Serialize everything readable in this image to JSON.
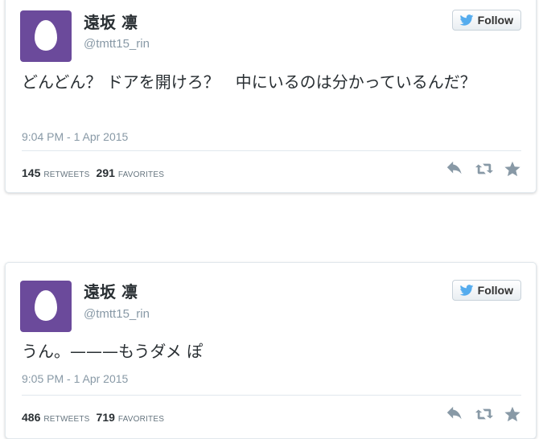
{
  "colors": {
    "avatar_bg": "#6b4a9b",
    "bird_blue": "#55acee",
    "action_gray": "#8899a6"
  },
  "follow_label": "Follow",
  "tweets": [
    {
      "user": {
        "name": "遠坂 凛",
        "handle": "@tmtt15_rin"
      },
      "text": "どんどん？ ドアを開けろ？　中にいるのは分かっているんだ？",
      "timestamp": "9:04 PM - 1 Apr 2015",
      "retweets": "145",
      "retweets_label": "RETWEETS",
      "favorites": "291",
      "favorites_label": "FAVORITES",
      "icons": [
        "reply-icon",
        "retweet-icon",
        "favorite-icon"
      ]
    },
    {
      "user": {
        "name": "遠坂 凛",
        "handle": "@tmtt15_rin"
      },
      "text": "うん。———もうダメ ぽ",
      "timestamp": "9:05 PM - 1 Apr 2015",
      "retweets": "486",
      "retweets_label": "RETWEETS",
      "favorites": "719",
      "favorites_label": "FAVORITES",
      "icons": [
        "reply-icon",
        "retweet-icon",
        "favorite-icon"
      ]
    }
  ]
}
